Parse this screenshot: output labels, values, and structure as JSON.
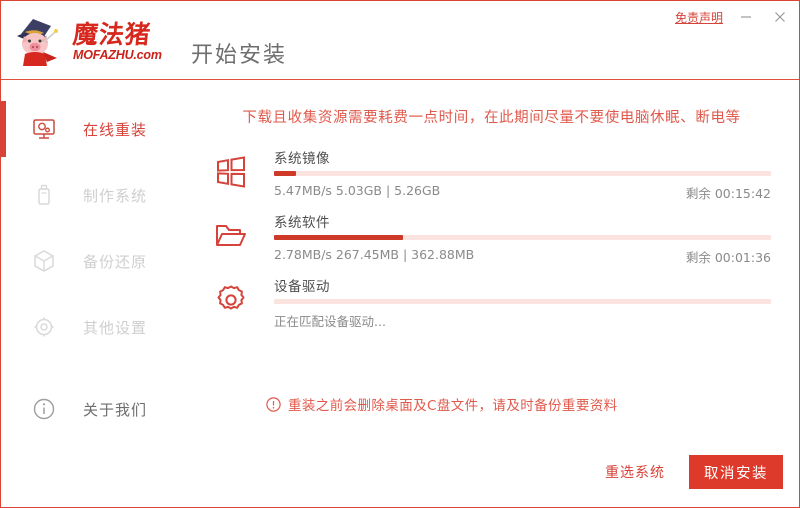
{
  "window": {
    "disclaimer_label": "免责声明",
    "minimize_label": "—",
    "close_label": "✕",
    "border_color": "#d94535"
  },
  "brand": {
    "name_cn": "魔法猪",
    "name_en": "MOFAZHU.com",
    "logo_color": "#d6281e",
    "mascot_icon": "pig-wizard-icon"
  },
  "header": {
    "title": "开始安装"
  },
  "sidebar": {
    "items": [
      {
        "label": "在线重装",
        "icon": "monitor-gear-icon",
        "state": "active"
      },
      {
        "label": "制作系统",
        "icon": "usb-drive-icon",
        "state": "disabled"
      },
      {
        "label": "备份还原",
        "icon": "cube-box-icon",
        "state": "disabled"
      },
      {
        "label": "其他设置",
        "icon": "gear-icon",
        "state": "disabled"
      },
      {
        "label": "关于我们",
        "icon": "info-circle-icon",
        "state": "normal"
      }
    ]
  },
  "main": {
    "warning_top": "下载且收集资源需要耗费一点时间，在此期间尽量不要使电脑休眠、断电等",
    "tasks": [
      {
        "name": "系统镜像",
        "icon": "windows-grid-icon",
        "stats": "5.47MB/s 5.03GB | 5.26GB",
        "eta": "剩余 00:15:42",
        "progress_pct": 4.5
      },
      {
        "name": "系统软件",
        "icon": "folder-open-icon",
        "stats": "2.78MB/s 267.45MB | 362.88MB",
        "eta": "剩余 00:01:36",
        "progress_pct": 26
      },
      {
        "name": "设备驱动",
        "icon": "gear-outline-icon",
        "stats": "正在匹配设备驱动...",
        "eta": "",
        "progress_pct": 0
      }
    ],
    "notice": {
      "icon": "alert-circle-icon",
      "text": "重装之前会删除桌面及C盘文件，请及时备份重要资料"
    }
  },
  "footer": {
    "reselect_label": "重选系统",
    "cancel_label": "取消安装",
    "accent_color": "#de3a2b"
  }
}
